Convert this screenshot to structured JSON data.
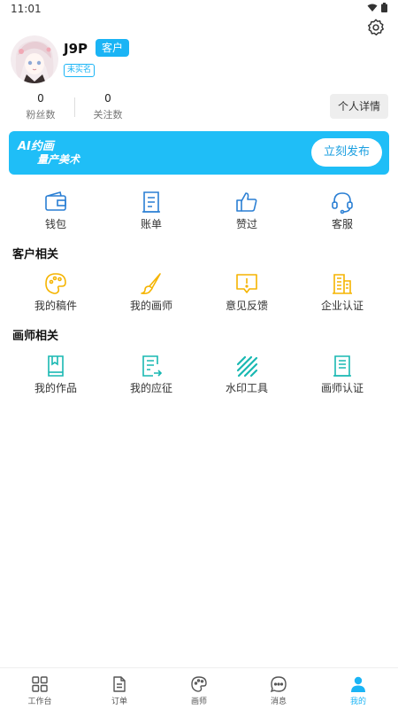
{
  "status_bar": {
    "time": "11:01"
  },
  "profile": {
    "username": "J9P",
    "role": "客户",
    "verification": "未实名"
  },
  "stats": [
    {
      "value": "0",
      "label": "粉丝数"
    },
    {
      "value": "0",
      "label": "关注数"
    }
  ],
  "detail_button": "个人详情",
  "banner": {
    "line1": "AI约画",
    "line2": "量产美术",
    "button": "立刻发布"
  },
  "quick_menu": [
    {
      "label": "钱包",
      "icon": "wallet-icon"
    },
    {
      "label": "账单",
      "icon": "bill-icon"
    },
    {
      "label": "赞过",
      "icon": "thumbs-up-icon"
    },
    {
      "label": "客服",
      "icon": "headset-icon"
    }
  ],
  "client_section": {
    "title": "客户相关",
    "items": [
      {
        "label": "我的稿件",
        "icon": "palette-icon"
      },
      {
        "label": "我的画师",
        "icon": "brush-icon"
      },
      {
        "label": "意见反馈",
        "icon": "feedback-icon"
      },
      {
        "label": "企业认证",
        "icon": "building-icon"
      }
    ]
  },
  "artist_section": {
    "title": "画师相关",
    "items": [
      {
        "label": "我的作品",
        "icon": "book-icon"
      },
      {
        "label": "我的应征",
        "icon": "apply-icon"
      },
      {
        "label": "水印工具",
        "icon": "watermark-icon"
      },
      {
        "label": "画师认证",
        "icon": "certificate-icon"
      }
    ]
  },
  "tabbar": [
    {
      "label": "工作台",
      "icon": "grid-icon"
    },
    {
      "label": "订单",
      "icon": "document-icon"
    },
    {
      "label": "画师",
      "icon": "palette-icon"
    },
    {
      "label": "消息",
      "icon": "chat-icon"
    },
    {
      "label": "我的",
      "icon": "user-icon",
      "active": true
    }
  ],
  "colors": {
    "accent": "#1ab4f5",
    "banner": "#1fbef7",
    "client_icons": "#f5b400",
    "artist_icons": "#19b8b2",
    "quick_icons": "#2a7fd4"
  }
}
